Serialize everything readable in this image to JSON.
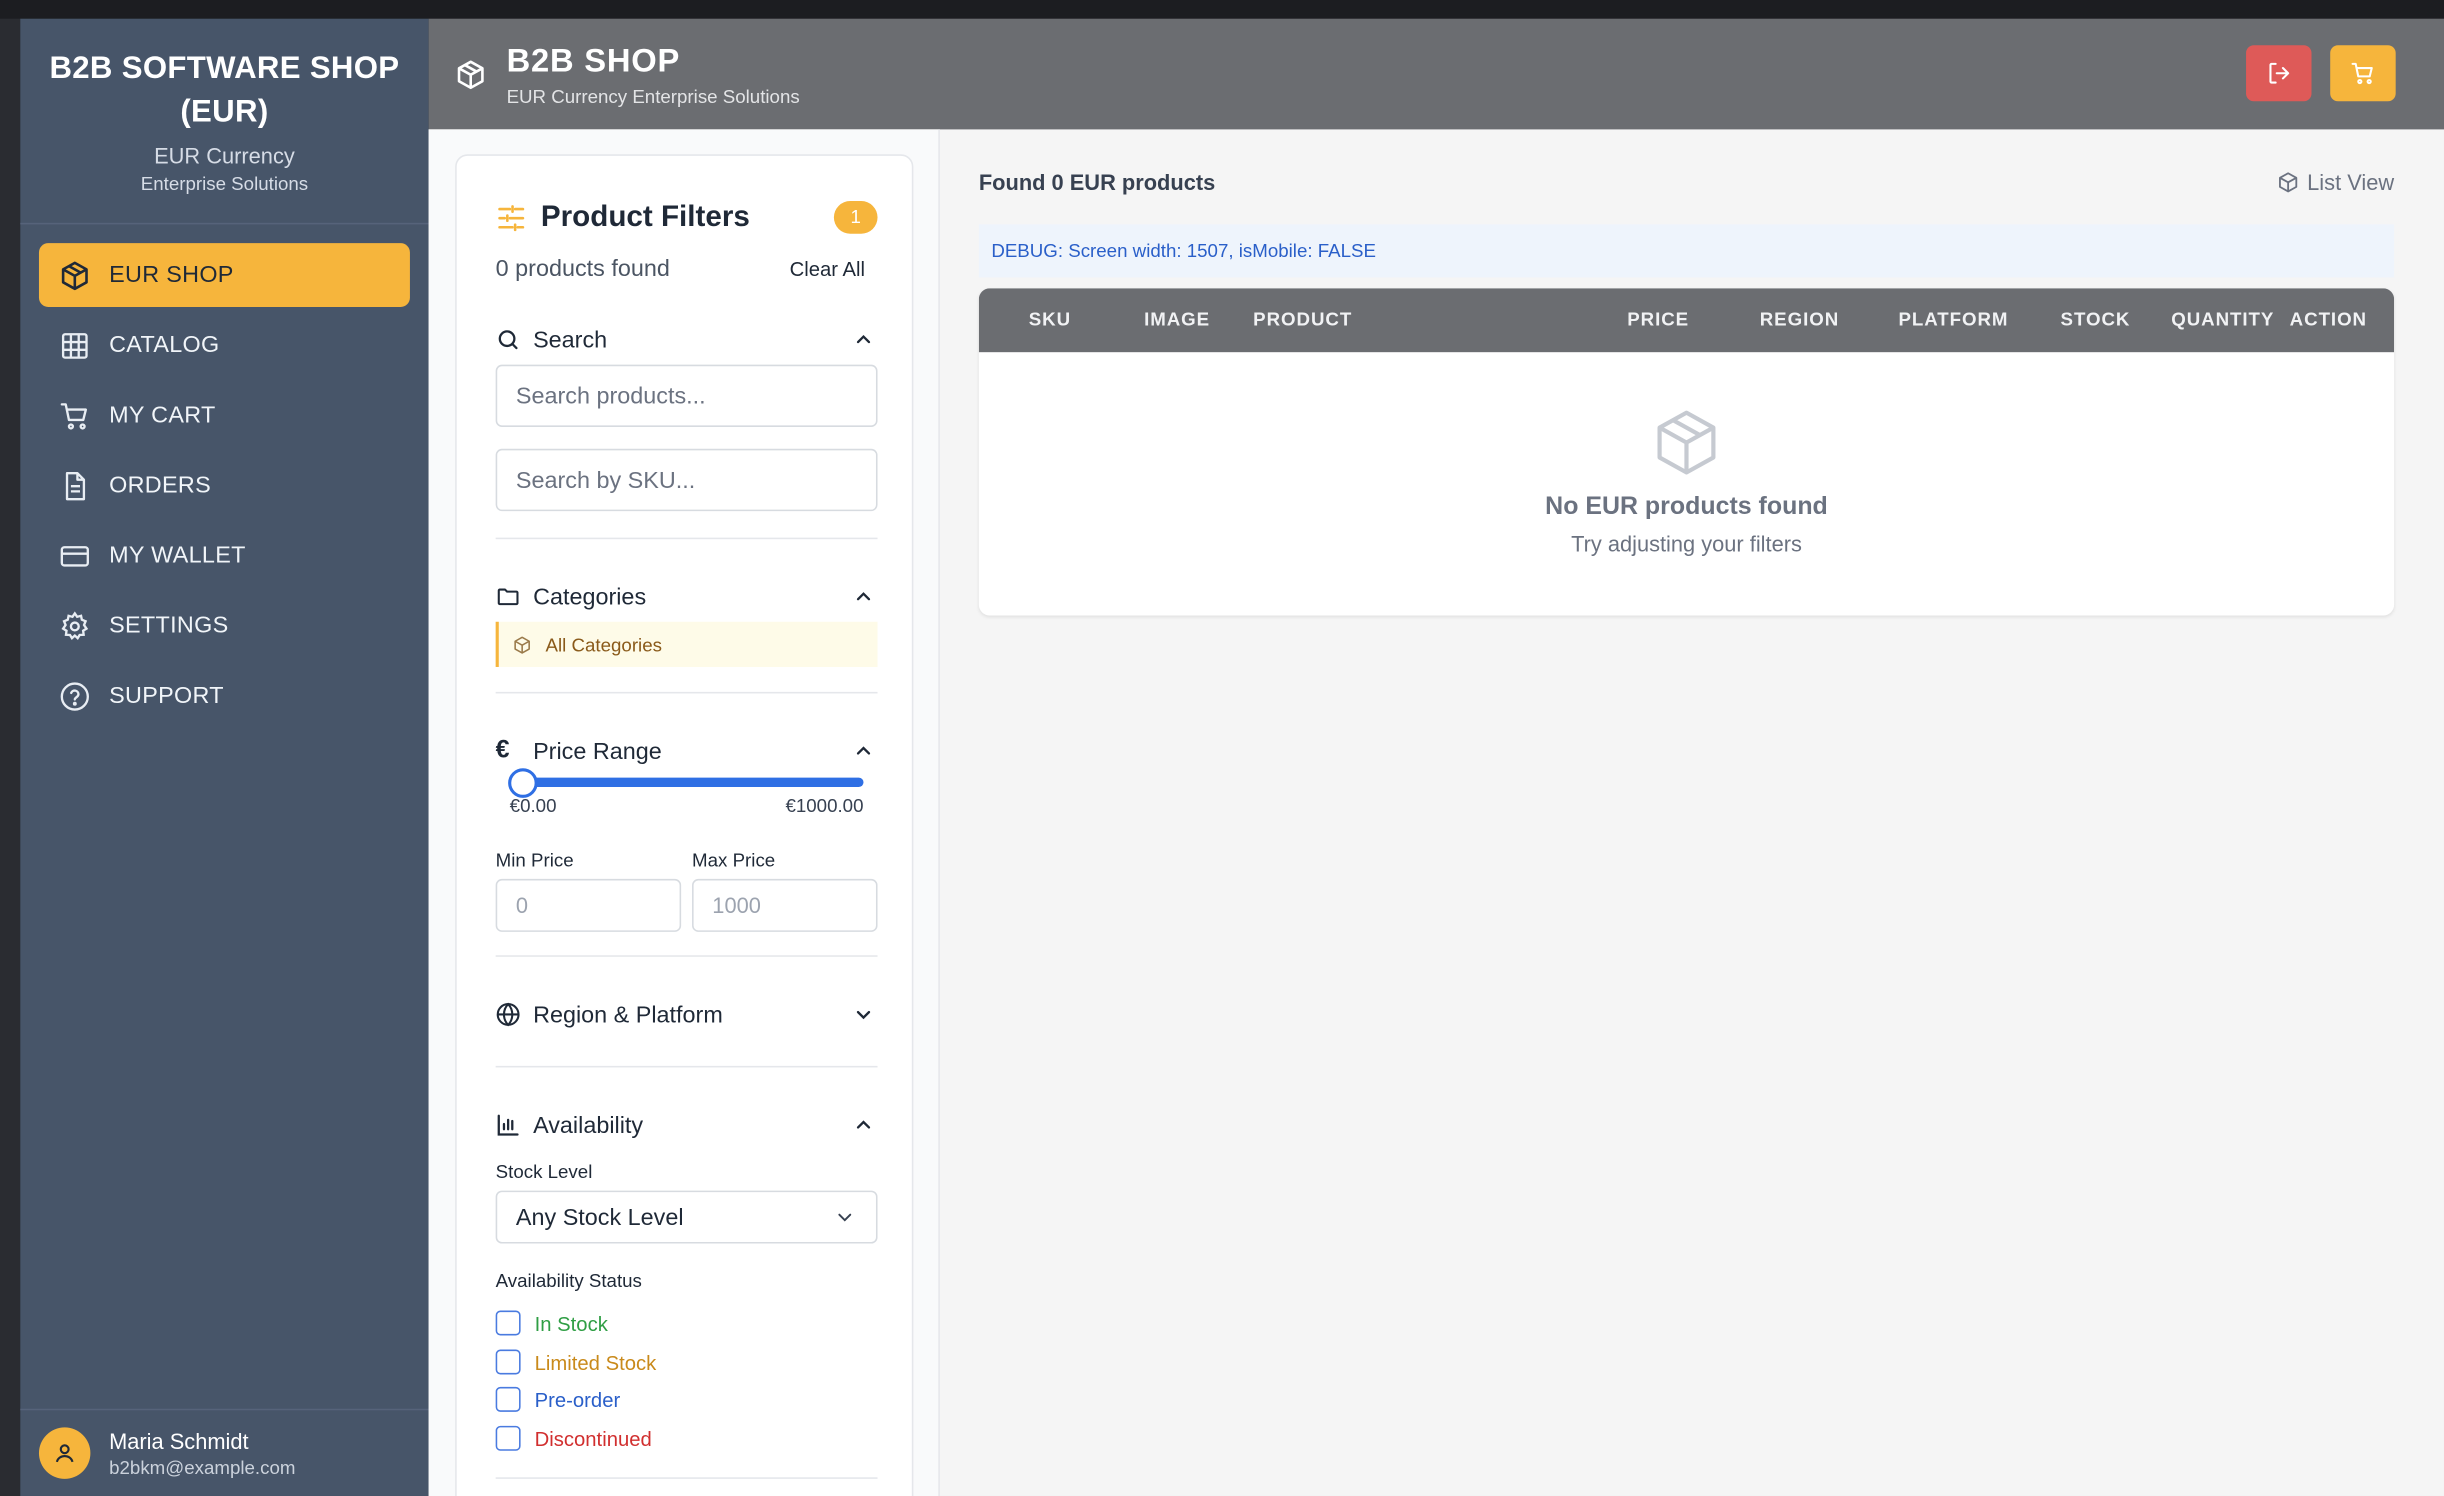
{
  "brand": {
    "title": "B2B SOFTWARE SHOP (EUR)",
    "subtitle": "EUR Currency",
    "subtitle2": "Enterprise Solutions"
  },
  "nav": [
    {
      "label": "EUR SHOP",
      "icon": "box-icon",
      "active": true
    },
    {
      "label": "CATALOG",
      "icon": "grid-icon",
      "active": false
    },
    {
      "label": "MY CART",
      "icon": "cart-icon",
      "active": false
    },
    {
      "label": "ORDERS",
      "icon": "document-icon",
      "active": false
    },
    {
      "label": "MY WALLET",
      "icon": "credit-card-icon",
      "active": false
    },
    {
      "label": "SETTINGS",
      "icon": "gear-icon",
      "active": false
    },
    {
      "label": "SUPPORT",
      "icon": "help-circle-icon",
      "active": false
    }
  ],
  "user": {
    "name": "Maria Schmidt",
    "email": "b2bkm@example.com"
  },
  "header": {
    "title": "B2B SHOP",
    "subtitle": "EUR Currency Enterprise Solutions"
  },
  "filters": {
    "title": "Product Filters",
    "badge": "1",
    "count_text": "0 products found",
    "clear_label": "Clear All",
    "search": {
      "heading": "Search",
      "product_placeholder": "Search products...",
      "sku_placeholder": "Search by SKU..."
    },
    "categories": {
      "heading": "Categories",
      "items": [
        "All Categories"
      ]
    },
    "price": {
      "heading": "Price Range",
      "range_min_label": "€0.00",
      "range_max_label": "€1000.00",
      "min_label": "Min Price",
      "max_label": "Max Price",
      "min_placeholder": "0",
      "max_placeholder": "1000",
      "slider_value": 0
    },
    "region": {
      "heading": "Region & Platform"
    },
    "availability": {
      "heading": "Availability",
      "stock_label": "Stock Level",
      "stock_value": "Any Stock Level",
      "status_label": "Availability Status",
      "statuses": [
        {
          "label": "In Stock",
          "color": "#2f9e44"
        },
        {
          "label": "Limited Stock",
          "color": "#c98a1b"
        },
        {
          "label": "Pre-order",
          "color": "#2a5fc9"
        },
        {
          "label": "Discontinued",
          "color": "#d12f2f"
        }
      ]
    }
  },
  "results": {
    "found_text": "Found 0 EUR products",
    "view_label": "List View",
    "debug_text": "DEBUG: Screen width: 1507, isMobile: FALSE",
    "columns": [
      "SKU",
      "IMAGE",
      "PRODUCT",
      "PRICE",
      "REGION",
      "PLATFORM",
      "STOCK",
      "QUANTITY",
      "ACTION"
    ],
    "empty_title": "No EUR products found",
    "empty_sub": "Try adjusting your filters"
  },
  "colors": {
    "accent": "#f6b53c",
    "sidebar": "#475569",
    "header": "#6b6d71",
    "logout": "#de5a58",
    "slider": "#2f6fe4"
  }
}
